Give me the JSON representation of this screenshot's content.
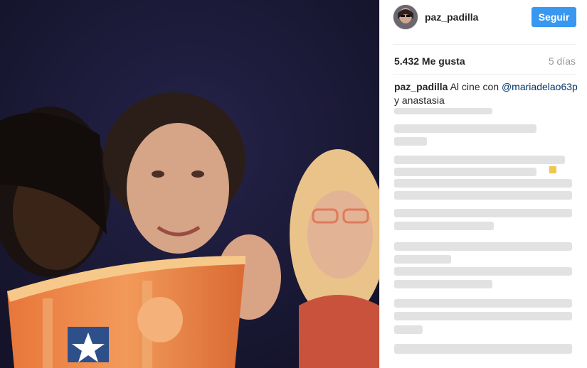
{
  "post": {
    "username": "paz_padilla",
    "follow_label": "Seguir",
    "likes": "5.432 Me gusta",
    "time": "5 días",
    "caption_user": "paz_padilla",
    "caption_text_1": "Al cine con",
    "caption_mention": "@mariadelao63p",
    "caption_text_2": "y anastasia"
  },
  "colors": {
    "follow_button": "#3897f0",
    "mention": "#003569",
    "muted": "#999999"
  },
  "icons": {
    "photo": "post-photo",
    "avatar": "avatar"
  }
}
